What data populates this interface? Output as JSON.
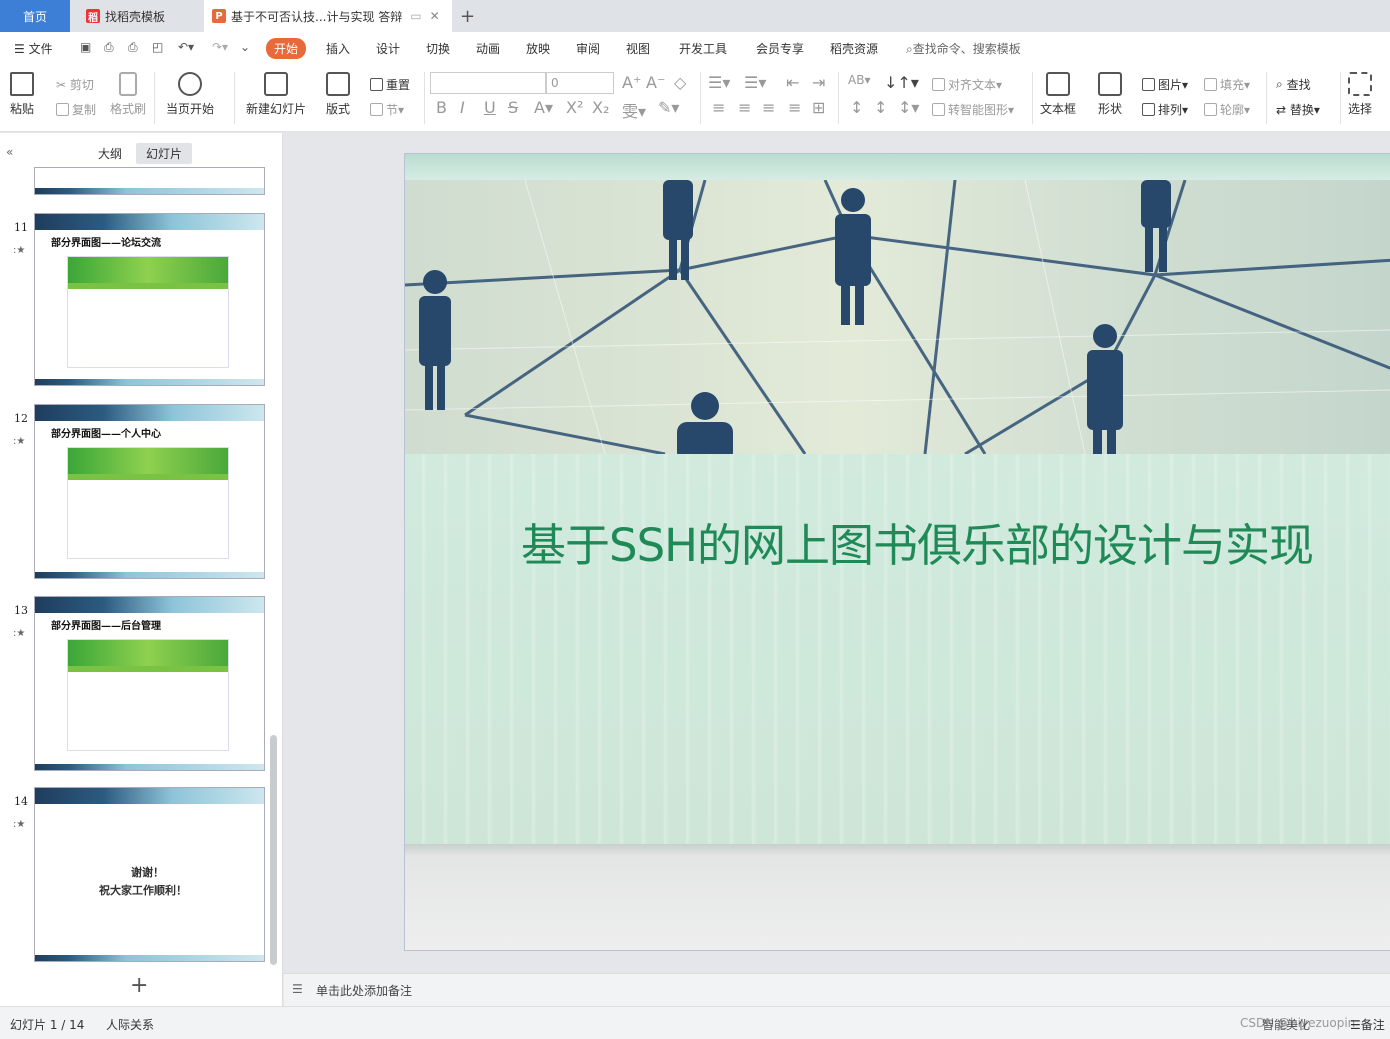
{
  "tabs": {
    "home": "首页",
    "template": "找稻壳模板",
    "doc": "基于不可否认技...计与实现 答辩"
  },
  "menu": {
    "file": "文件",
    "items": [
      "开始",
      "插入",
      "设计",
      "切换",
      "动画",
      "放映",
      "审阅",
      "视图",
      "开发工具",
      "会员专享",
      "稻壳资源"
    ],
    "search": "查找命令、搜索模板"
  },
  "ribbon": {
    "paste": "粘贴",
    "cut": "剪切",
    "copy": "复制",
    "format_painter": "格式刷",
    "from_current": "当页开始",
    "new_slide": "新建幻灯片",
    "layout": "版式",
    "reset": "重置",
    "section": "节",
    "font_size": "0",
    "align_text": "对齐文本",
    "smart_art": "转智能图形",
    "textbox": "文本框",
    "shape": "形状",
    "picture": "图片",
    "fill": "填充",
    "arrange": "排列",
    "outline": "轮廓",
    "find": "查找",
    "replace": "替换",
    "select": "选择"
  },
  "left_pane": {
    "outline_tab": "大纲",
    "slides_tab": "幻灯片",
    "thumbs": [
      {
        "num": "11",
        "title": "部分界面图——论坛交流"
      },
      {
        "num": "12",
        "title": "部分界面图——个人中心"
      },
      {
        "num": "13",
        "title": "部分界面图——后台管理"
      },
      {
        "num": "14",
        "line1": "谢谢！",
        "line2": "祝大家工作顺利！"
      }
    ],
    "add": "+"
  },
  "slide": {
    "title": "基于SSH的网上图书俱乐部的设计与实现"
  },
  "notes": {
    "placeholder": "单击此处添加备注"
  },
  "status": {
    "slide_info": "幻灯片 1 / 14",
    "theme": "人际关系",
    "smart": "智能美化",
    "notes": "备注",
    "watermark": "CSDN @biyezuopin"
  }
}
